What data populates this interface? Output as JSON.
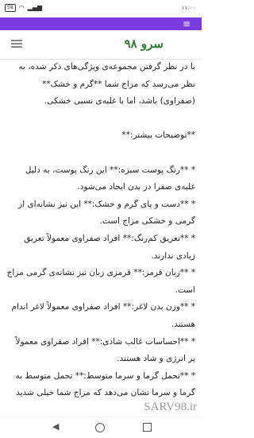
{
  "status_bar": {
    "time": "۱۱:۰۰",
    "battery": "58",
    "signal": "▂▄▆",
    "wifi": "◠"
  },
  "site": {
    "logo": "سرو ۹۸",
    "watermark": "SARV98.ir"
  },
  "article": {
    "p1": "با در نظر گرفتن مجموعه‌ی ویژگی‌های ذکر شده، به نظر می‌رسد که مزاج شما **گرم و خشک** (صفراوی) باشد، اما با غلبه‌ی نسبی خشکی.",
    "p2": "**توضیحات بیشتر:**",
    "p3": "* **رنگ پوست سبزه:** این رنگ پوست، به دلیل غلبه‌ی صفرا در بدن ایجاد می‌شود.",
    "p4": "* **دست و پای گرم و خشک:** این نیز نشانه‌ای از گرمی و خشکی مزاج است.",
    "p5": "* **تعریق کم‌رنگ:** افراد صفراوی معمولاً تعریق زیادی ندارند.",
    "p6": "* **زبان قرمز:** قرمزی زبان نیز نشانه‌ی گرمی مزاج است.",
    "p7": "* **وزن بدن لاغر:** افراد صفراوی معمولاً لاغر اندام هستند.",
    "p8": "* **احساسات غالب شادی:** افراد صفراوی معمولاً پر انرژی و شاد هستند.",
    "p9": "* **تحمل گرما و سرما متوسط:** تحمل متوسط به گرما و سرما نشان می‌دهد که مزاج شما خیلی شدید"
  }
}
